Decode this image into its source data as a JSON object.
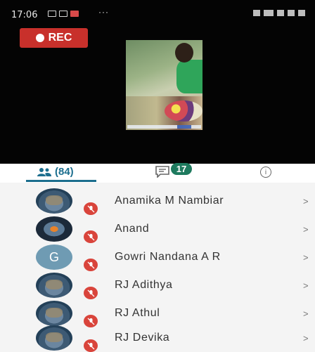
{
  "status_bar": {
    "time": "17:06",
    "dots": "···"
  },
  "video": {
    "rec_label": "REC"
  },
  "tabs": {
    "participants_count": "(84)",
    "chat_count": "17"
  },
  "participants": [
    {
      "name": "Anamika M Nambiar",
      "avatar": "photo",
      "mic": "muted"
    },
    {
      "name": "Anand",
      "avatar": "photo-dark",
      "mic": "muted"
    },
    {
      "name": "Gowri Nandana A R",
      "avatar": "letter",
      "initial": "G",
      "mic": "muted"
    },
    {
      "name": "RJ Adithya",
      "avatar": "photo",
      "mic": "muted"
    },
    {
      "name": "RJ Athul",
      "avatar": "photo",
      "mic": "muted"
    },
    {
      "name": "RJ Devika",
      "avatar": "photo",
      "mic": "muted"
    }
  ],
  "colors": {
    "accent": "#1b6e8e",
    "rec": "#c8302b",
    "muted_badge": "#d9443b",
    "chat_badge": "#1e7a5e"
  }
}
